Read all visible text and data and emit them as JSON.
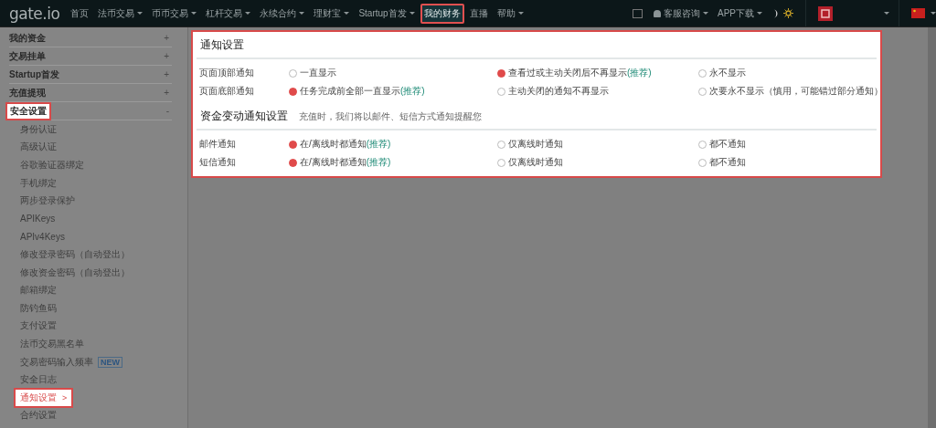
{
  "nav": {
    "logo": "gate.io",
    "items": [
      {
        "label": "首页",
        "has_menu": false,
        "highlighted": false
      },
      {
        "label": "法币交易",
        "has_menu": true,
        "highlighted": false
      },
      {
        "label": "币币交易",
        "has_menu": true,
        "highlighted": false
      },
      {
        "label": "杠杆交易",
        "has_menu": true,
        "highlighted": false
      },
      {
        "label": "永续合约",
        "has_menu": true,
        "highlighted": false
      },
      {
        "label": "理财宝",
        "has_menu": true,
        "highlighted": false
      },
      {
        "label": "Startup首发",
        "has_menu": true,
        "highlighted": false
      },
      {
        "label": "我的财务",
        "has_menu": false,
        "highlighted": true
      },
      {
        "label": "直播",
        "has_menu": false,
        "highlighted": false
      },
      {
        "label": "帮助",
        "has_menu": true,
        "highlighted": false
      }
    ],
    "right": [
      {
        "label": "客服咨询",
        "has_menu": true
      },
      {
        "label": "APP下载",
        "has_menu": true
      }
    ]
  },
  "sidebar": {
    "groups": [
      {
        "label": "我的资金",
        "toggle": "+",
        "highlighted": false
      },
      {
        "label": "交易挂单",
        "toggle": "+",
        "highlighted": false
      },
      {
        "label": "Startup首发",
        "toggle": "+",
        "highlighted": false
      },
      {
        "label": "充值提现",
        "toggle": "+",
        "highlighted": false
      },
      {
        "label": "安全设置",
        "toggle": "-",
        "highlighted": true,
        "children": [
          {
            "label": "身份认证",
            "highlighted": false
          },
          {
            "label": "高级认证",
            "highlighted": false
          },
          {
            "label": "谷歌验证器绑定",
            "highlighted": false
          },
          {
            "label": "手机绑定",
            "highlighted": false
          },
          {
            "label": "两步登录保护",
            "highlighted": false
          },
          {
            "label": "APIKeys",
            "highlighted": false
          },
          {
            "label": "APIv4Keys",
            "highlighted": false
          },
          {
            "label": "修改登录密码（自动登出）",
            "highlighted": false
          },
          {
            "label": "修改资金密码（自动登出）",
            "highlighted": false
          },
          {
            "label": "邮箱绑定",
            "highlighted": false
          },
          {
            "label": "防钓鱼码",
            "highlighted": false
          },
          {
            "label": "支付设置",
            "highlighted": false
          },
          {
            "label": "法币交易黑名单",
            "highlighted": false
          },
          {
            "label": "交易密码输入频率",
            "badge": "NEW",
            "highlighted": false
          },
          {
            "label": "安全日志",
            "highlighted": false
          },
          {
            "label": "通知设置",
            "arrow": ">",
            "highlighted": true
          },
          {
            "label": "合约设置",
            "highlighted": false
          }
        ]
      }
    ]
  },
  "panel": {
    "highlighted": true,
    "sections": [
      {
        "title": "通知设置",
        "rows": [
          {
            "label": "页面顶部通知",
            "options": [
              {
                "label": "一直显示",
                "selected": false
              },
              {
                "label": "查看过或主动关闭后不再显示",
                "recommended": "(推荐)",
                "selected": true
              },
              {
                "label": "永不显示",
                "selected": false
              }
            ]
          },
          {
            "label": "页面底部通知",
            "options": [
              {
                "label": "任务完成前全部一直显示",
                "recommended": "(推荐)",
                "selected": true
              },
              {
                "label": "主动关闭的通知不再显示",
                "selected": false
              },
              {
                "label": "次要永不显示（慎用，可能错过部分通知）",
                "selected": false
              }
            ]
          }
        ]
      },
      {
        "title": "资金变动通知设置",
        "note": "充值时，我们将以邮件、短信方式通知提醒您",
        "rows": [
          {
            "label": "邮件通知",
            "options": [
              {
                "label": "在/离线时都通知",
                "recommended": "(推荐)",
                "selected": true
              },
              {
                "label": "仅离线时通知",
                "selected": false
              },
              {
                "label": "都不通知",
                "selected": false
              }
            ]
          },
          {
            "label": "短信通知",
            "options": [
              {
                "label": "在/离线时都通知",
                "recommended": "(推荐)",
                "selected": true
              },
              {
                "label": "仅离线时通知",
                "selected": false
              },
              {
                "label": "都不通知",
                "selected": false
              }
            ]
          }
        ]
      }
    ]
  }
}
